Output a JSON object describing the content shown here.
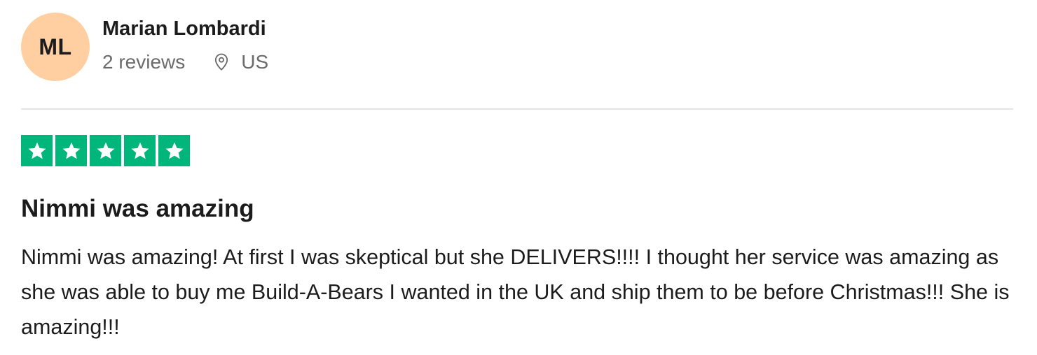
{
  "reviewer": {
    "initials": "ML",
    "avatar_color": "#ffcfa1",
    "name": "Marian Lombardi",
    "reviews_count": "2 reviews",
    "location_icon": "map-pin-icon",
    "country": "US"
  },
  "rating": {
    "stars": 5,
    "max_stars": 5,
    "color": "#00b67a"
  },
  "review": {
    "title": "Nimmi was amazing",
    "body": "Nimmi was amazing! At first I was skeptical but she DELIVERS!!!! I thought her service was amazing as she was able to buy me Build-A-Bears I wanted in the UK and ship them to be before Christmas!!! She is amazing!!!"
  }
}
